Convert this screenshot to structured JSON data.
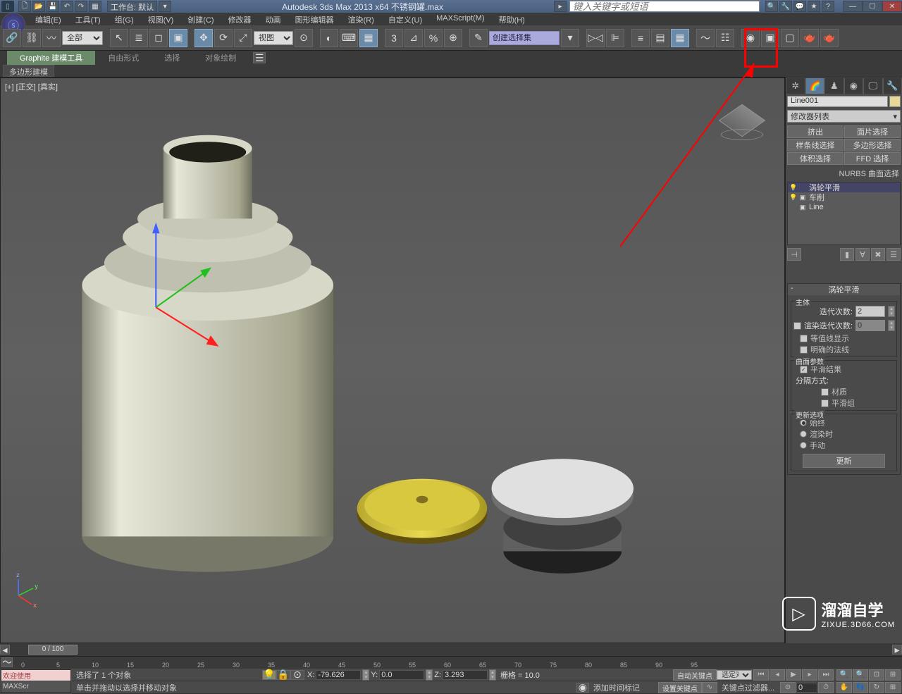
{
  "titlebar": {
    "workspace_label": "工作台: 默认",
    "app_title": "Autodesk 3ds Max  2013 x64   不锈钢罐.max",
    "search_placeholder": "键入关键字或短语"
  },
  "menus": [
    "编辑(E)",
    "工具(T)",
    "组(G)",
    "视图(V)",
    "创建(C)",
    "修改器",
    "动画",
    "图形编辑器",
    "渲染(R)",
    "自定义(U)",
    "MAXScript(M)",
    "帮助(H)"
  ],
  "main_toolbar": {
    "all_filter": "全部",
    "ref_coord": "视图",
    "named_selection": "创建选择集"
  },
  "ribbon": {
    "tabs": [
      "Graphite 建模工具",
      "自由形式",
      "选择",
      "对象绘制"
    ],
    "sub": "多边形建模"
  },
  "viewport": {
    "label": "[+] [正交] [真实]"
  },
  "cmd_panel": {
    "object_name": "Line001",
    "modifier_list_label": "修改器列表",
    "sel_buttons": [
      "挤出",
      "面片选择",
      "样条线选择",
      "多边形选择",
      "体积选择",
      "FFD 选择"
    ],
    "nurbs_label": "NURBS 曲面选择",
    "stack": {
      "items": [
        {
          "icon": "💡",
          "exp": "",
          "name": "涡轮平滑",
          "sel": true
        },
        {
          "icon": "💡",
          "exp": "▣",
          "name": "车削",
          "sel": false
        },
        {
          "icon": "",
          "exp": "▣",
          "name": "Line",
          "sel": false
        }
      ]
    },
    "rollout_title": "涡轮平滑",
    "group_main": "主体",
    "iterations_label": "迭代次数:",
    "iterations_value": "2",
    "render_iters_label": "渲染迭代次数:",
    "render_iters_value": "0",
    "isoline_label": "等值线显示",
    "explicit_normals_label": "明确的法线",
    "surface_params_title": "曲面参数",
    "smooth_result_label": "平滑结果",
    "separate_by_label": "分隔方式:",
    "material_label": "材质",
    "smooth_group_label": "平滑组",
    "update_options_title": "更新选项",
    "radio_always": "始终",
    "radio_render": "渲染时",
    "radio_manual": "手动",
    "update_button": "更新"
  },
  "timeline": {
    "slider_text": "0 / 100",
    "ticks": [
      "0",
      "5",
      "10",
      "15",
      "20",
      "25",
      "30",
      "35",
      "40",
      "45",
      "50",
      "55",
      "60",
      "65",
      "70",
      "75",
      "80",
      "85",
      "90",
      "95"
    ]
  },
  "status": {
    "welcome": "欢迎使用",
    "maxscript": "MAXScr",
    "selected_text": "选择了 1 个对象",
    "prompt_text": "单击并拖动以选择并移动对象",
    "coords": {
      "x_label": "X:",
      "x": "-79.626",
      "y_label": "Y:",
      "y": "0.0",
      "z_label": "Z:",
      "z": "3.293"
    },
    "grid_label": "栅格 = 10.0",
    "add_time_tag": "添加时间标记",
    "autokey": "自动关键点",
    "setkey": "设置关键点",
    "key_filter_sel": "选定对",
    "key_filter_label": "关键点过滤器..."
  },
  "watermark": {
    "cn": "溜溜自学",
    "url": "ZIXUE.3D66.COM"
  }
}
